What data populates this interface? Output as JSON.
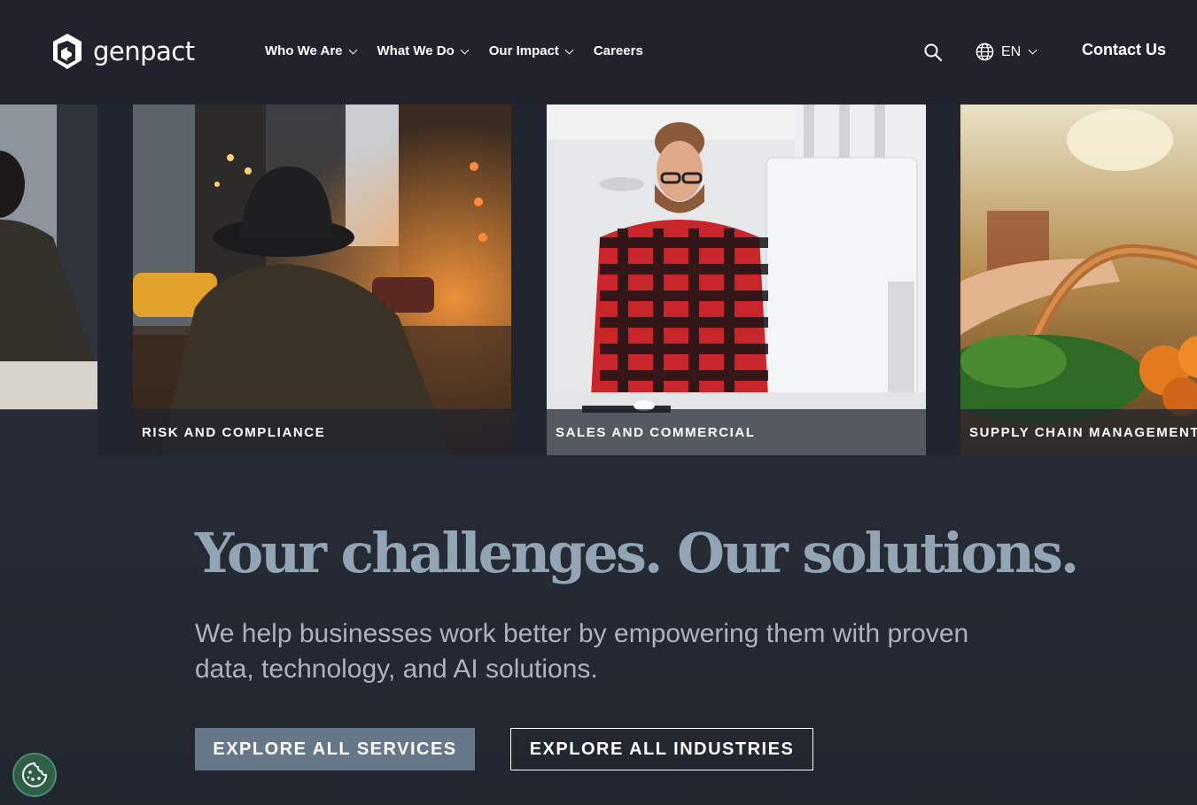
{
  "header": {
    "logo_text": "genpact",
    "nav": [
      {
        "label": "Who We Are",
        "has_dropdown": true
      },
      {
        "label": "What We Do",
        "has_dropdown": true
      },
      {
        "label": "Our Impact",
        "has_dropdown": true
      },
      {
        "label": "Careers",
        "has_dropdown": false
      }
    ],
    "language": "EN",
    "contact_label": "Contact Us"
  },
  "carousel": {
    "cards": [
      {
        "label": "",
        "icon": "meeting-photo"
      },
      {
        "label": "RISK AND COMPLIANCE",
        "icon": "rainy-street-photo"
      },
      {
        "label": "SALES AND COMMERCIAL",
        "icon": "office-worker-photo"
      },
      {
        "label": "SUPPLY CHAIN MANAGEMENT",
        "icon": "produce-basket-photo"
      }
    ]
  },
  "hero": {
    "headline": "Your challenges. Our solutions.",
    "subhead": "We help businesses work better by empowering them with proven data, technology, and AI solutions.",
    "primary_button": "EXPLORE ALL SERVICES",
    "secondary_button": "EXPLORE ALL INDUSTRIES"
  },
  "colors": {
    "header_bg": "#20232c",
    "page_bg": "#21252f",
    "headline": "#93a4b5",
    "primary_button": "#67778a",
    "cookie_badge": "#2f5f47"
  }
}
